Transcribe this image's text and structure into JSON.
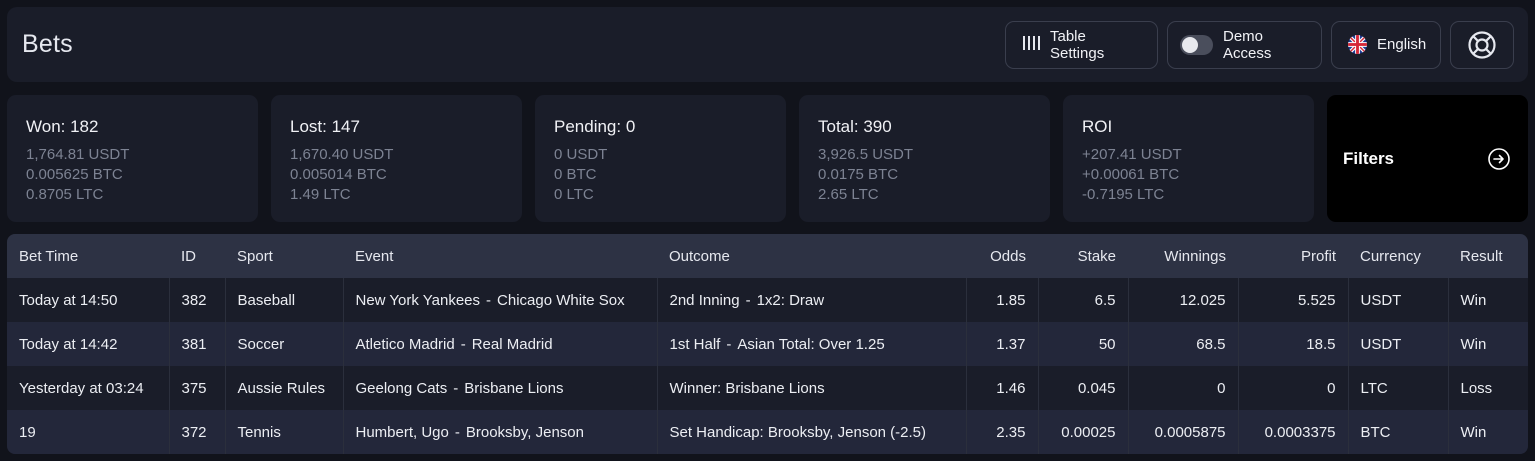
{
  "header": {
    "title": "Bets",
    "table_settings_label": "Table Settings",
    "demo_label": "Demo Access",
    "demo_enabled": false,
    "language_label": "English"
  },
  "stats": {
    "won": {
      "title": "Won: 182",
      "lines": [
        "1,764.81 USDT",
        "0.005625 BTC",
        "0.8705 LTC"
      ]
    },
    "lost": {
      "title": "Lost: 147",
      "lines": [
        "1,670.40 USDT",
        "0.005014 BTC",
        "1.49 LTC"
      ]
    },
    "pending": {
      "title": "Pending: 0",
      "lines": [
        "0 USDT",
        "0 BTC",
        "0 LTC"
      ]
    },
    "total": {
      "title": "Total: 390",
      "lines": [
        "3,926.5 USDT",
        "0.0175 BTC",
        "2.65 LTC"
      ]
    },
    "roi": {
      "title": "ROI",
      "lines": [
        "+207.41 USDT",
        "+0.00061 BTC",
        "-0.7195 LTC"
      ]
    }
  },
  "filters": {
    "label": "Filters"
  },
  "table": {
    "headers": {
      "bet_time": "Bet Time",
      "id": "ID",
      "sport": "Sport",
      "event": "Event",
      "outcome": "Outcome",
      "odds": "Odds",
      "stake": "Stake",
      "winnings": "Winnings",
      "profit": "Profit",
      "currency": "Currency",
      "result": "Result"
    },
    "rows": [
      {
        "bet_time": "Today at 14:50",
        "id": "382",
        "sport": "Baseball",
        "event_a": "New York Yankees",
        "event_b": "Chicago White Sox",
        "outcome_a": "2nd Inning",
        "outcome_b": "1x2: Draw",
        "odds": "1.85",
        "stake": "6.5",
        "winnings": "12.025",
        "profit": "5.525",
        "currency": "USDT",
        "result": "Win"
      },
      {
        "bet_time": "Today at 14:42",
        "id": "381",
        "sport": "Soccer",
        "event_a": "Atletico Madrid",
        "event_b": "Real Madrid",
        "outcome_a": "1st Half",
        "outcome_b": "Asian Total: Over 1.25",
        "odds": "1.37",
        "stake": "50",
        "winnings": "68.5",
        "profit": "18.5",
        "currency": "USDT",
        "result": "Win"
      },
      {
        "bet_time": "Yesterday at 03:24",
        "id": "375",
        "sport": "Aussie Rules",
        "event_a": "Geelong Cats",
        "event_b": "Brisbane Lions",
        "outcome_a": "",
        "outcome_b": "Winner: Brisbane Lions",
        "odds": "1.46",
        "stake": "0.045",
        "winnings": "0",
        "profit": "0",
        "currency": "LTC",
        "result": "Loss"
      },
      {
        "bet_time": "19",
        "id": "372",
        "sport": "Tennis",
        "event_a": "Humbert, Ugo",
        "event_b": "Brooksby, Jenson",
        "outcome_a": "",
        "outcome_b": "Set Handicap: Brooksby, Jenson (-2.5)",
        "odds": "2.35",
        "stake": "0.00025",
        "winnings": "0.0005875",
        "profit": "0.0003375",
        "currency": "BTC",
        "result": "Win"
      }
    ]
  }
}
